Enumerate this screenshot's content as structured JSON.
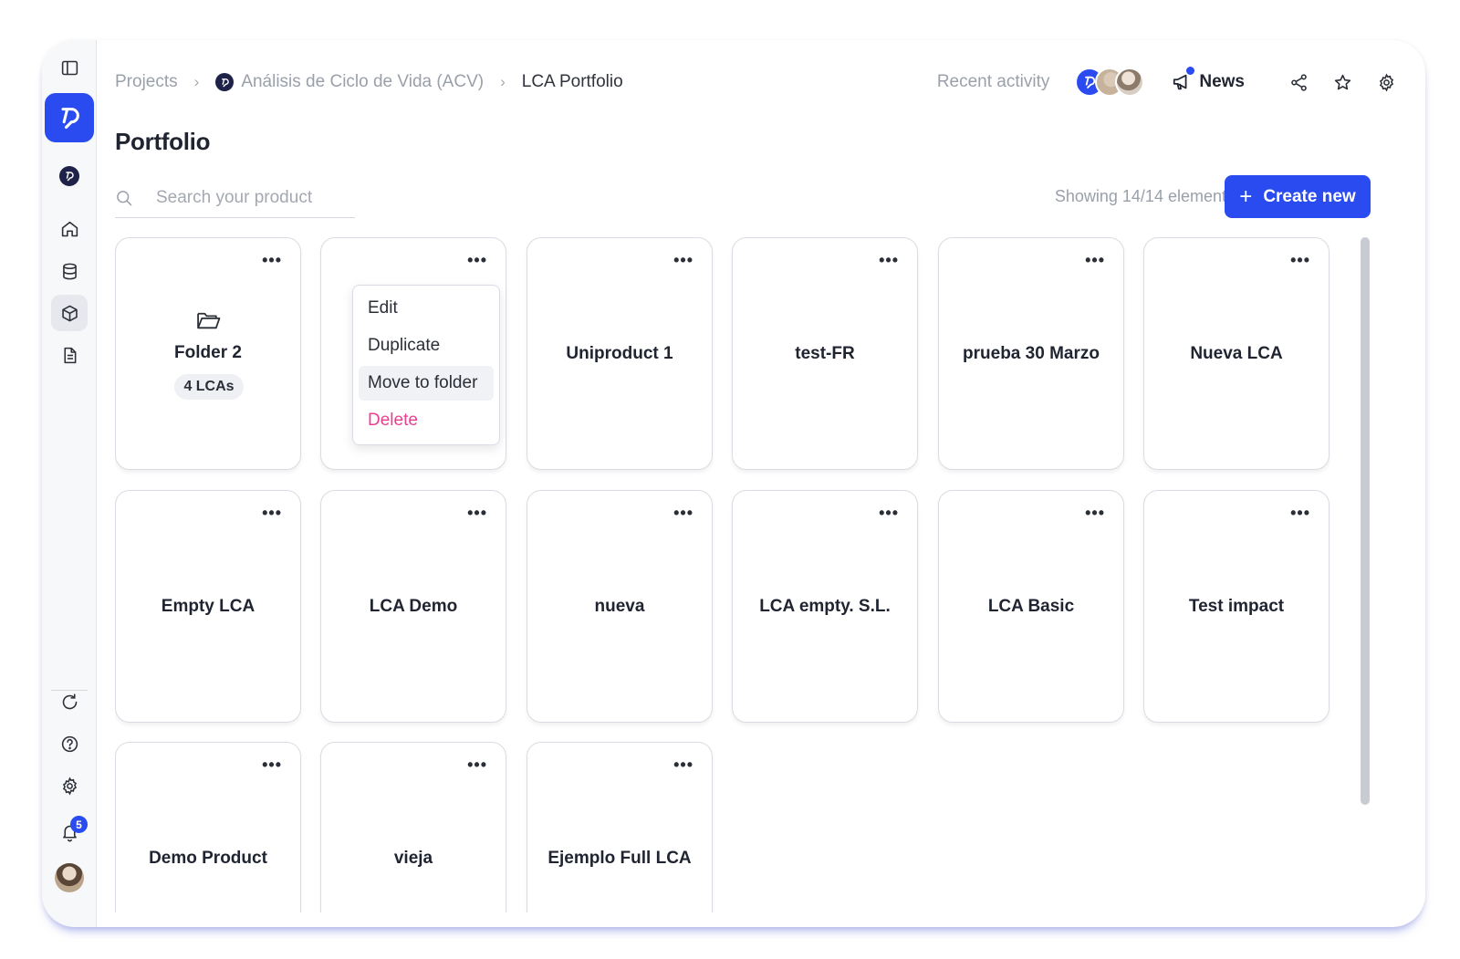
{
  "breadcrumbs": [
    "Projects",
    "Análisis de Ciclo de Vida (ACV)",
    "LCA Portfolio"
  ],
  "top_right": {
    "recent_activity": "Recent activity",
    "news_label": "News"
  },
  "page_title": "Portfolio",
  "search": {
    "placeholder": "Search your product",
    "value": ""
  },
  "showing_text": "Showing 14/14 elements",
  "create_button": "Create new",
  "sidebar": {
    "items": [
      "panel-toggle-icon",
      "logo",
      "project",
      "home-icon",
      "database-icon",
      "cube-icon",
      "document-icon",
      "refresh-icon",
      "help-icon",
      "settings-icon",
      "bell-icon",
      "avatar"
    ],
    "notification_count": "5"
  },
  "folder": {
    "name": "Folder 2",
    "count_label": "4 LCAs"
  },
  "cards": [
    "Uniproduct 1",
    "test-FR",
    "prueba 30 Marzo",
    "Nueva LCA",
    "Empty LCA",
    "LCA Demo",
    "nueva",
    "LCA empty. S.L.",
    "LCA Basic",
    "Test impact",
    "Demo Product",
    "vieja",
    "Ejemplo Full LCA"
  ],
  "context_menu": {
    "items": [
      "Edit",
      "Duplicate",
      "Move to folder",
      "Delete"
    ],
    "hovered": "Move to folder",
    "danger_color": "#ea3f8f"
  },
  "colors": {
    "accent": "#2a4bf0",
    "sidebar_bg": "#f7f8fa",
    "card_border": "#d9dce2"
  }
}
